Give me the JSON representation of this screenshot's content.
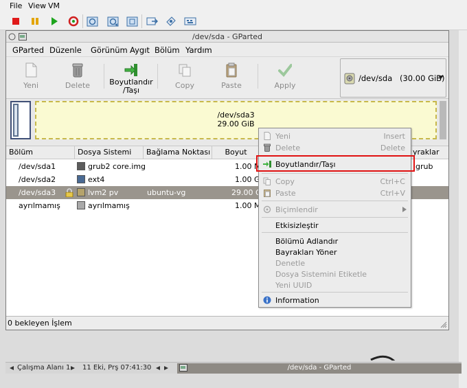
{
  "host": {
    "menu": [
      "File",
      "View",
      "VM"
    ],
    "toolbar_icons": [
      "stop-icon",
      "pause-icon",
      "play-icon",
      "reset-icon",
      "snapshot-icon",
      "snapshot-restore-icon",
      "snapshot-manager-icon",
      "removable-devices-icon",
      "settings-icon",
      "send-keys-icon"
    ]
  },
  "window": {
    "title": "/dev/sda - GParted"
  },
  "menubar": [
    "GParted",
    "Düzenle",
    "Görünüm",
    "Aygıt",
    "Bölüm",
    "Yardım"
  ],
  "toolbar": {
    "new": "Yeni",
    "delete": "Delete",
    "resize_line1": "Boyutlandır",
    "resize_line2": "/Taşı",
    "copy": "Copy",
    "paste": "Paste",
    "apply": "Apply",
    "device": "/dev/sda",
    "device_size": "(30.00 GiB)"
  },
  "diskmap": {
    "partition": "/dev/sda3",
    "size": "29.00 GiB"
  },
  "table": {
    "headers": [
      "Bölüm",
      "Dosya Sistemi",
      "Bağlama Noktası",
      "Boyut",
      "yraklar"
    ],
    "rows": [
      {
        "partition": "/dev/sda1",
        "fs": "grub2 core.img",
        "mount": "",
        "size": "1.00 M",
        "flags": "grub",
        "color": "#5c5c5c"
      },
      {
        "partition": "/dev/sda2",
        "fs": "ext4",
        "mount": "",
        "size": "1.00 G",
        "flags": "",
        "color": "#4a6a93"
      },
      {
        "partition": "/dev/sda3",
        "fs": "lvm2 pv",
        "mount": "ubuntu-vg",
        "size": "29.00 G",
        "flags": "",
        "color": "#b5a36b"
      },
      {
        "partition": "ayrılmamış",
        "fs": "ayrılmamış",
        "mount": "",
        "size": "1.00 M",
        "flags": "",
        "color": "#a9a9a9"
      }
    ]
  },
  "status": "0 bekleyen İşlem",
  "context_menu": {
    "items": [
      {
        "label": "Yeni",
        "accel": "Insert",
        "enabled": false
      },
      {
        "label": "Delete",
        "accel": "Delete",
        "enabled": false
      },
      {
        "label": "Boyutlandır/Taşı",
        "accel": "",
        "enabled": true
      },
      {
        "label": "Copy",
        "accel": "Ctrl+C",
        "enabled": false
      },
      {
        "label": "Paste",
        "accel": "Ctrl+V",
        "enabled": false
      },
      {
        "label": "Biçimlendir",
        "accel": "",
        "enabled": false
      },
      {
        "label": "Etkisizleştir",
        "accel": "",
        "enabled": true
      },
      {
        "label": "Bölümü Adlandır",
        "accel": "",
        "enabled": true
      },
      {
        "label": "Bayrakları Yöner",
        "accel": "",
        "enabled": true
      },
      {
        "label": "Denetle",
        "accel": "",
        "enabled": false
      },
      {
        "label": "Dosya Sistemini Etiketle",
        "accel": "",
        "enabled": false
      },
      {
        "label": "Yeni UUID",
        "accel": "",
        "enabled": false
      },
      {
        "label": "Information",
        "accel": "",
        "enabled": true
      }
    ]
  },
  "panel": {
    "workspace": "Çalışma Alanı 1",
    "datetime": "11 Eki, Prş 07:41:30",
    "task": "/dev/sda - GParted"
  },
  "colors": {
    "highlight_box": "#e01010",
    "selected_row": "#9a958d",
    "diskmap_fill": "#fafad2"
  }
}
